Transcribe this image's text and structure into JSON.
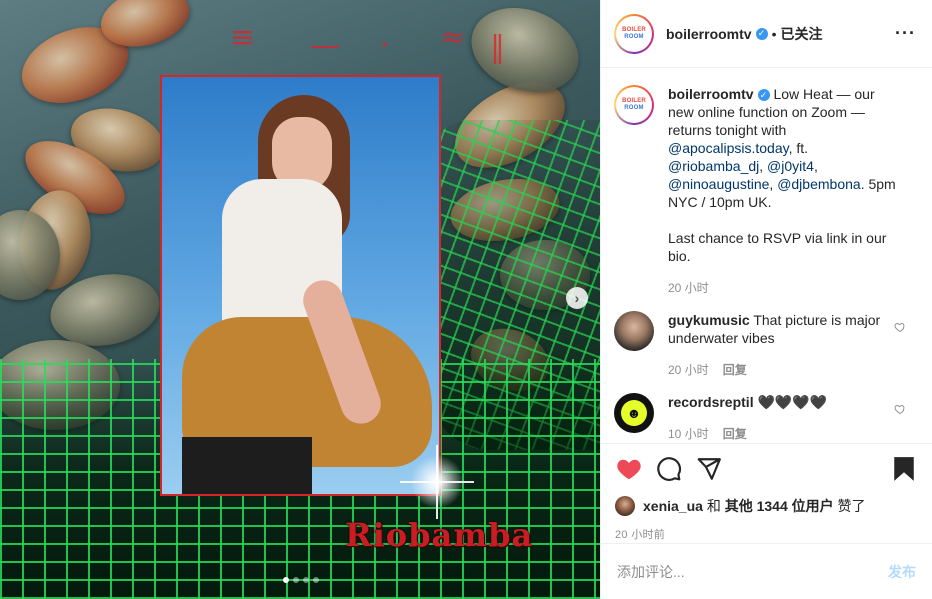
{
  "post": {
    "account": "boilerroomtv",
    "logo_lines": [
      "BOILER",
      "ROOM"
    ],
    "follow_status": "已关注",
    "dot": "•",
    "more_icon": "more-horizontal-icon",
    "overlay_text": "Riobamba",
    "next_icon": "›"
  },
  "caption": {
    "user": "boilerroomtv",
    "part1": "Low Heat — our new online function on Zoom — returns tonight with ",
    "mention1": "@apocalipsis.today",
    "part2": ", ft. ",
    "mention2": "@riobamba_dj",
    "sep1": ", ",
    "mention3": "@j0yit4",
    "sep2": ", ",
    "mention4": "@ninoaugustine",
    "sep3": ", ",
    "mention5": "@djbembona",
    "part3": ". 5pm NYC / 10pm UK.",
    "part4": "Last chance to RSVP via link in our bio.",
    "time": "20 小时"
  },
  "comments": [
    {
      "user": "guykumusic",
      "text": "That picture is major underwater vibes",
      "time": "20 小时",
      "reply": "回复"
    },
    {
      "user": "recordsreptil",
      "text": "🖤🖤🖤🖤",
      "time": "10 小时",
      "reply": "回复",
      "avatar_text": "☻"
    }
  ],
  "likes": {
    "user": "xenia_ua",
    "and": "和",
    "others": "其他 1344 位用户",
    "suffix": "赞了"
  },
  "post_time": "20 小时前",
  "comment_box": {
    "placeholder": "添加评论...",
    "post_label": "发布"
  },
  "colors": {
    "like_red": "#ed4956",
    "link_blue": "#00376b",
    "verified_blue": "#3897f0",
    "overlay_red": "#c91d23",
    "grid_green": "#28dc5a"
  }
}
